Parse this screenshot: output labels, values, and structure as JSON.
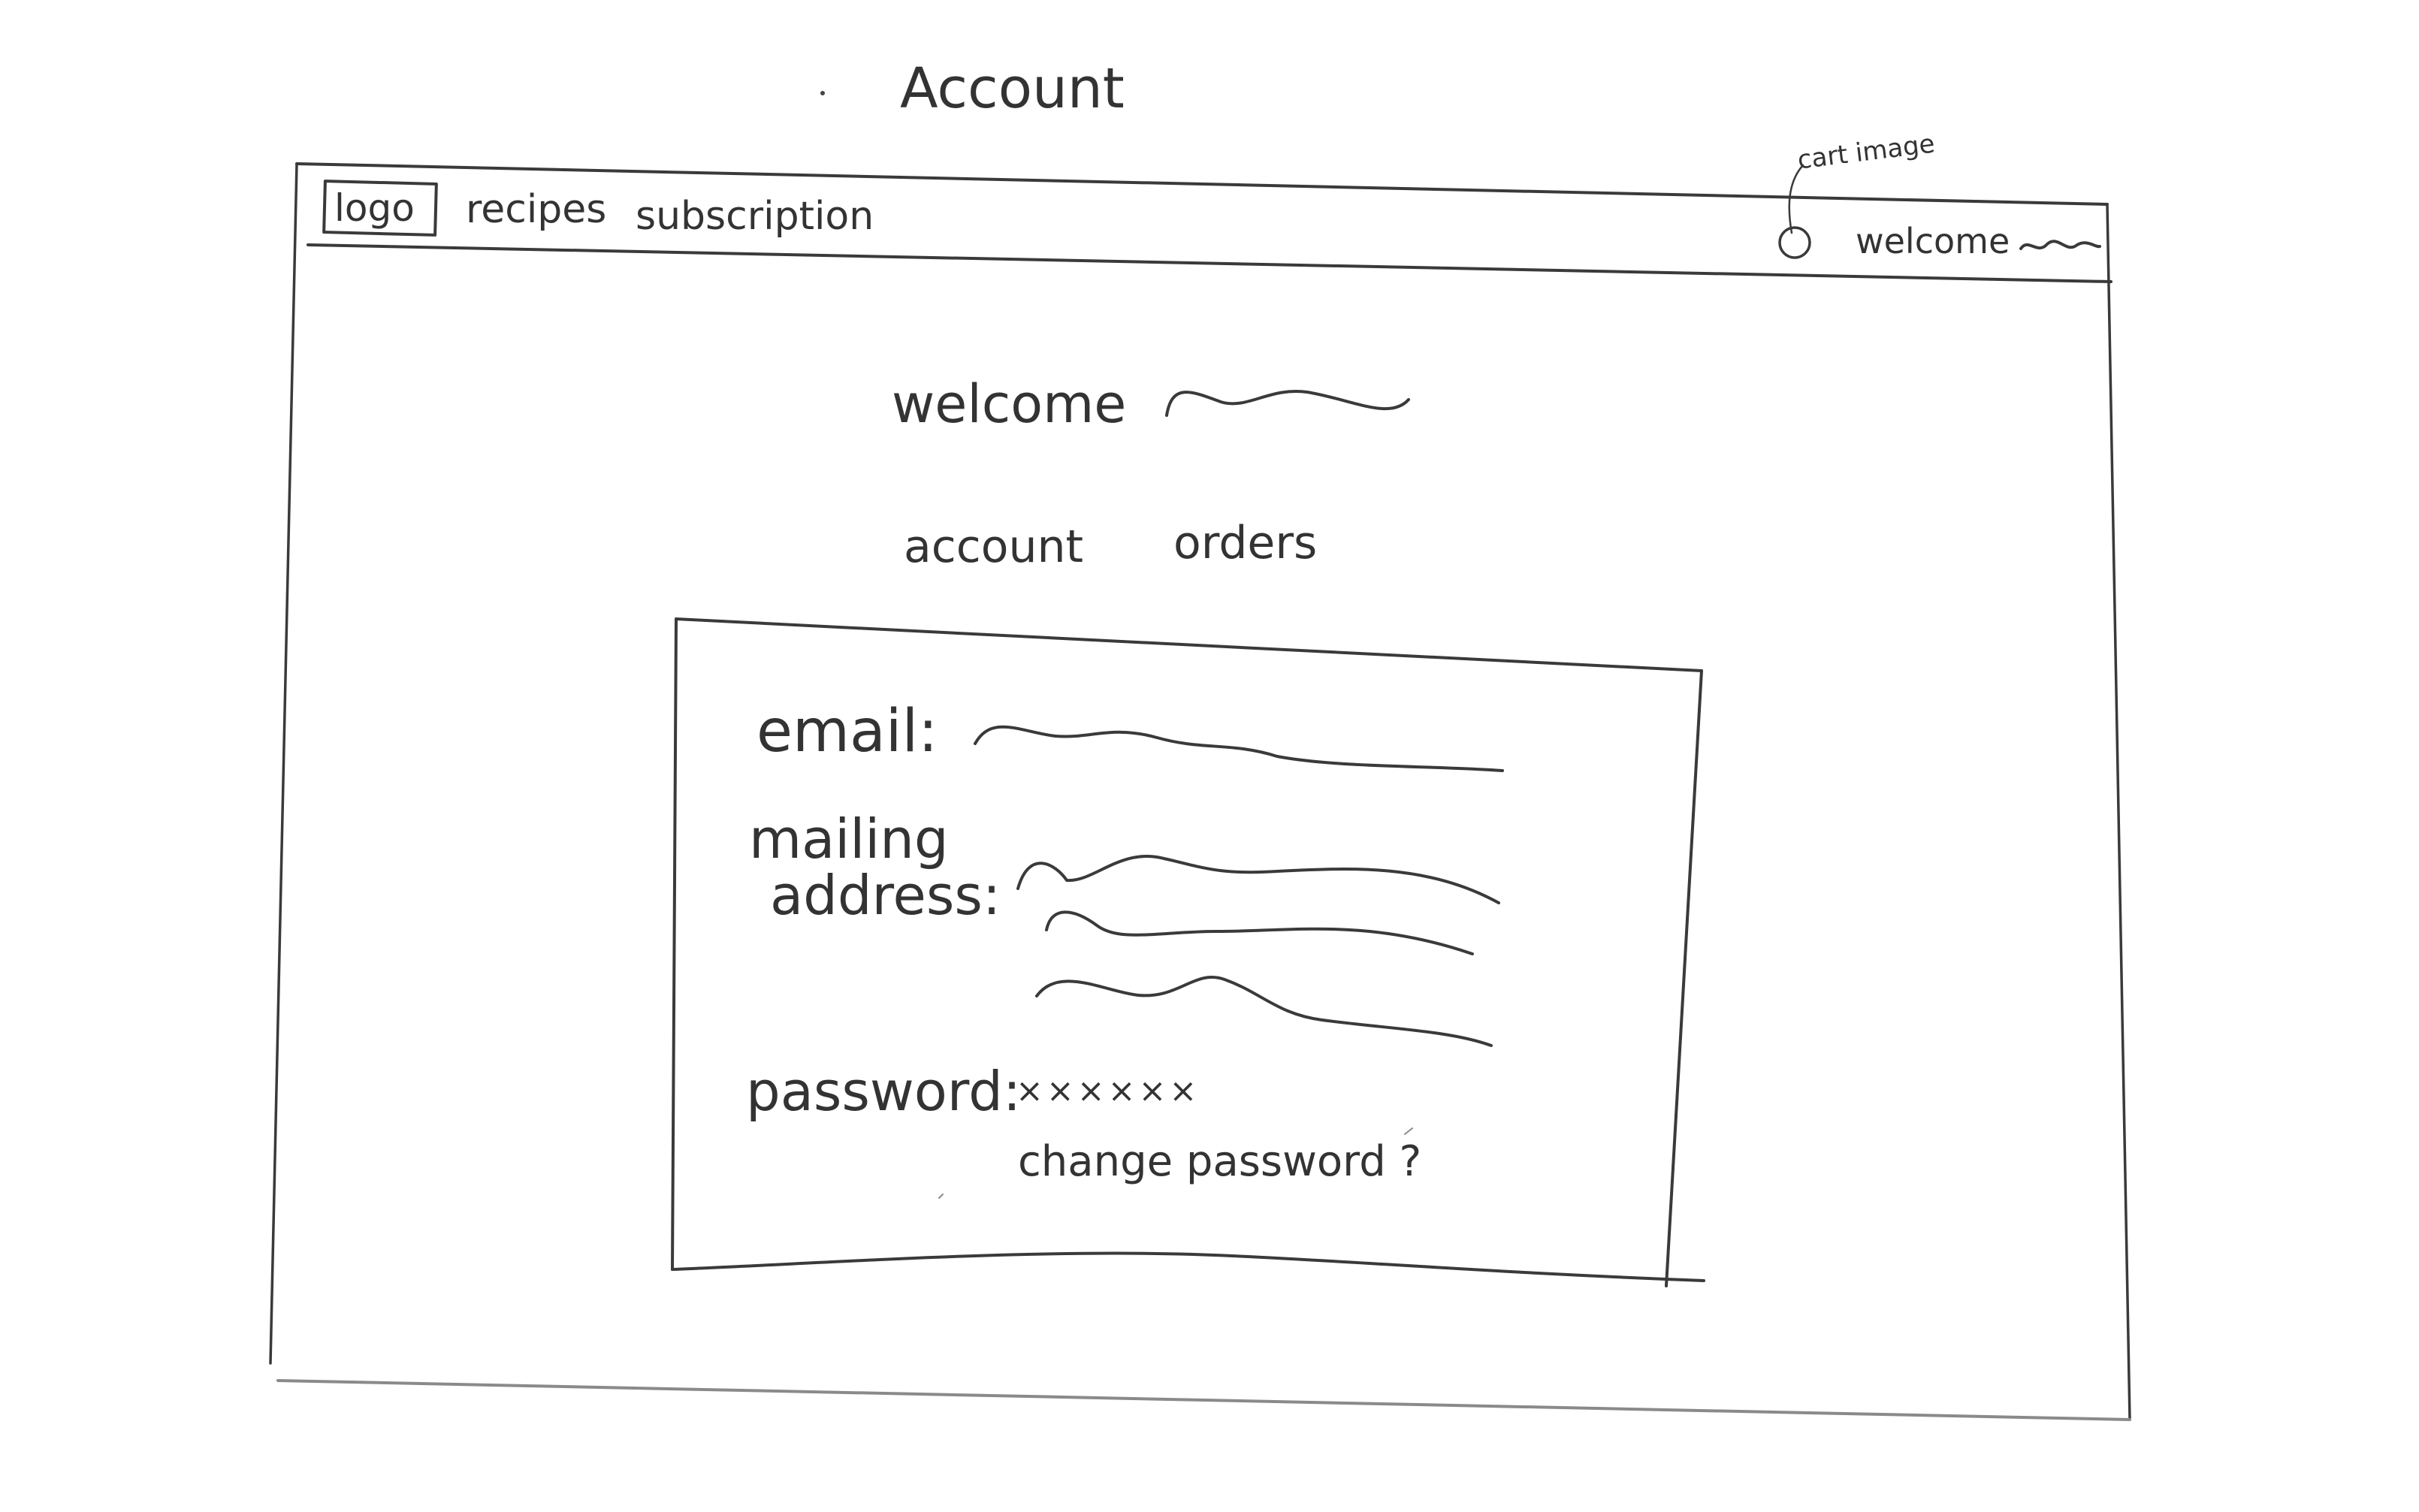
{
  "page": {
    "title": "Account"
  },
  "navbar": {
    "logo": "logo",
    "links": [
      "recipes",
      "subscription"
    ],
    "welcome": "welcome",
    "cart_annotation": "cart image"
  },
  "main": {
    "welcome": "welcome",
    "tabs": [
      "account",
      "orders"
    ]
  },
  "account_form": {
    "email_label": "email:",
    "mailing_label_line1": "mailing",
    "mailing_label_line2": "address:",
    "password_label": "password:",
    "password_value": "××××××",
    "change_password": "change password ?"
  },
  "icons": {
    "cart": "cart-icon"
  },
  "colors": {
    "pencil": "#3a3a3a",
    "paper": "#ffffff"
  }
}
